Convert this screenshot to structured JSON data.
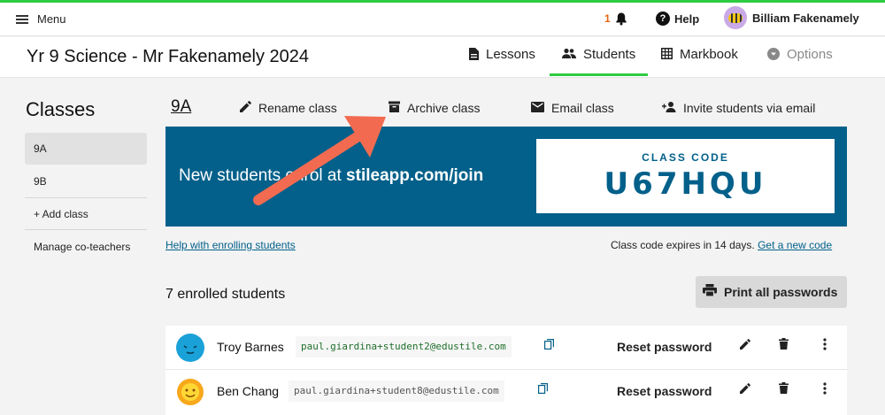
{
  "colors": {
    "accent": "#2ecc40",
    "brand": "#02608a",
    "arrow": "#f26b50"
  },
  "topbar": {
    "menu_label": "Menu",
    "notification_count": "1",
    "help_label": "Help",
    "user_name": "Billiam Fakenamely"
  },
  "header": {
    "page_title": "Yr 9 Science - Mr Fakenamely 2024",
    "tabs": [
      {
        "label": "Lessons",
        "icon": "document-icon"
      },
      {
        "label": "Students",
        "icon": "people-icon",
        "active": true
      },
      {
        "label": "Markbook",
        "icon": "grid-icon"
      },
      {
        "label": "Options",
        "icon": "chevron-circle-icon"
      }
    ]
  },
  "sidebar": {
    "title": "Classes",
    "items": [
      {
        "label": "9A",
        "selected": true
      },
      {
        "label": "9B"
      },
      {
        "label": "+ Add class"
      },
      {
        "label": "Manage co-teachers"
      }
    ]
  },
  "class": {
    "name": "9A",
    "actions": {
      "rename": "Rename class",
      "archive": "Archive class",
      "email": "Email class",
      "invite": "Invite students via email"
    },
    "banner_text_plain": "New students enrol at ",
    "banner_text_bold": "stileapp.com/join",
    "code_label": "CLASS CODE",
    "code_value": "U67HQU",
    "help_link": "Help with enrolling students",
    "expiry_text": "Class code expires in 14 days. ",
    "new_code_link": "Get a new code",
    "enrolled_count_text": "7 enrolled students",
    "print_label": "Print all passwords"
  },
  "students": [
    {
      "name": "Troy Barnes",
      "email": "paul.giardina+student2@edustile.com",
      "reset_label": "Reset password"
    },
    {
      "name": "Ben Chang",
      "email": "paul.giardina+student8@edustile.com",
      "reset_label": "Reset password"
    }
  ]
}
